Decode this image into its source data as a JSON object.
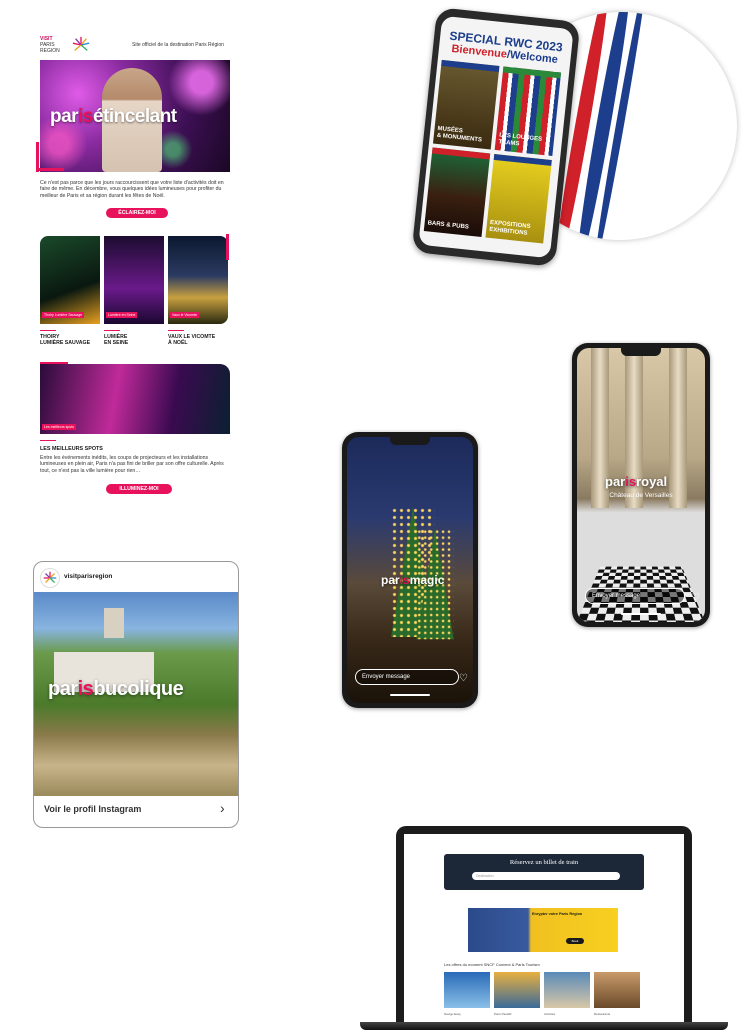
{
  "newsletter": {
    "logo_line1": "VISIT",
    "logo_line2": "PARIS",
    "logo_line3": "REGION",
    "site_label": "Site officiel de la destination Paris Région",
    "hero_title_pre": "par",
    "hero_title_is": "is",
    "hero_title_post": "étincelant",
    "intro_text": "Ce n'est pas parce que les jours raccourcissent que votre liste d'activités doit en faire de même. En décembre, vous quelques idées lumineuses pour profiter du meilleur de Paris et sa région durant les fêtes de Noël.",
    "cta_1": "ÉCLAIREZ-MOI",
    "cards": [
      {
        "tag": "Thoiry Lumière Sauvage",
        "label_1": "THOIRY",
        "label_2": "LUMIÈRE SAUVAGE"
      },
      {
        "tag": "Lumière en Seine",
        "label_1": "LUMIÈRE",
        "label_2": "EN SEINE"
      },
      {
        "tag": "Vaux le Vicomte",
        "label_1": "VAUX LE VICOMTE",
        "label_2": "À NOËL"
      }
    ],
    "spot_tag": "Les meilleurs spots",
    "spot_title": "LES MEILLEURS SPOTS",
    "spot_text": "Entre les événements inédits, les coups de projecteurs et les installations lumineuses en plein air, Paris n'a pas fini de briller par son offre culturelle. Après tout, ce n'est pas la ville lumière pour rien…",
    "cta_2": "ILLUMINEZ-MOI"
  },
  "rwc": {
    "title": "SPECIAL RWC 2023",
    "subtitle_fr": "Bienvenue",
    "subtitle_sep": "/",
    "subtitle_en": "Welcome",
    "tiles": [
      {
        "line1": "MUSÉES",
        "line2": "& MONUMENTS"
      },
      {
        "line1": "LES LOUNGES",
        "line2": "TEAMS"
      },
      {
        "line1": "BARS & PUBS",
        "line2": ""
      },
      {
        "line1": "EXPOSITIONS",
        "line2": "EXHIBITIONS"
      }
    ]
  },
  "story_magic": {
    "brand_pre": "par",
    "brand_is": "is",
    "brand_post": "magic",
    "message_placeholder": "Envoyer message",
    "heart_icon": "heart-icon"
  },
  "story_royal": {
    "brand_pre": "par",
    "brand_is": "is",
    "brand_post": "royal",
    "subtitle": "Château de Versailles",
    "message_placeholder": "Envoyer message",
    "heart_icon": "heart-icon"
  },
  "instagram": {
    "username": "visitparisregion",
    "title_pre": "par",
    "title_is": "is",
    "title_post": "bucolique",
    "footer_link": "Voir le profil Instagram",
    "chevron_icon": "chevron-right-icon"
  },
  "laptop": {
    "hero_title": "Réservez un billet de train",
    "search_placeholder": "Destination",
    "promo_text": "Enrypter votre Paris Region",
    "promo_button": "Book",
    "section_title": "Les offres du moment SNCF Connect & Paris Tourism",
    "thumb_captions": [
      "Navigo Easy",
      "Paris Passlib'",
      "Activités",
      "Restaurants"
    ]
  },
  "colors": {
    "accent_pink": "#e8115b",
    "rwc_blue": "#1c3e8c",
    "rwc_red": "#d0202a"
  }
}
